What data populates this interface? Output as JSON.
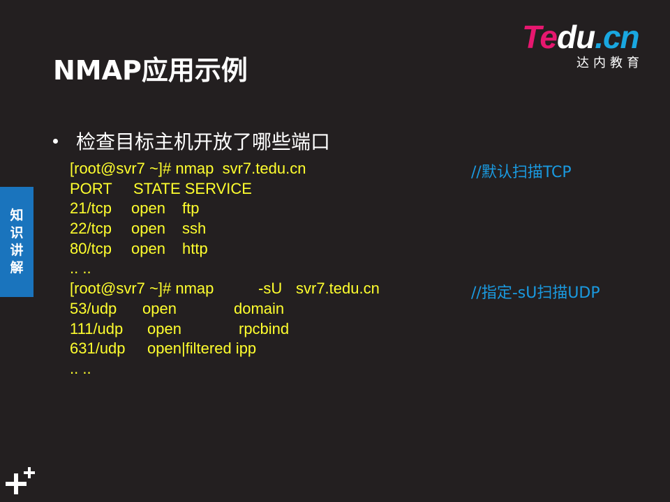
{
  "logo": {
    "word_part1": "Te",
    "word_part2": "du",
    "word_part3": ".cn",
    "subtitle": "达内教育"
  },
  "title": "NMAP应用示例",
  "side_tab": {
    "chars": [
      "知",
      "识",
      "讲",
      "解"
    ]
  },
  "bullet": "检查目标主机开放了哪些端口",
  "code_lines": [
    [
      "[root@svr7 ~]# nmap  svr7.tedu.cn"
    ],
    [
      "PORT",
      "STATE SERVICE"
    ],
    [
      "21/tcp",
      "open",
      "ftp"
    ],
    [
      "22/tcp",
      "open",
      "ssh"
    ],
    [
      "80/tcp",
      "open",
      "http"
    ],
    [
      ".. .."
    ],
    [
      "[root@svr7 ~]# nmap",
      "-sU",
      "svr7.tedu.cn"
    ],
    [
      "53/udp",
      "open",
      "domain"
    ],
    [
      "111/udp",
      "open",
      "rpcbind"
    ],
    [
      "631/udp",
      "open|filtered ipp"
    ],
    [
      ".. .."
    ]
  ],
  "comments": {
    "tcp": "//默认扫描TCP",
    "udp": "//指定-sU扫描UDP"
  },
  "colors": {
    "background": "#231f20",
    "code": "#ffff2e",
    "comment": "#1a9ae0",
    "tab": "#1a74bd",
    "logo_pink": "#e6176f",
    "logo_blue": "#19a7e0"
  },
  "icons": {
    "corner": "plus-plus-icon"
  }
}
